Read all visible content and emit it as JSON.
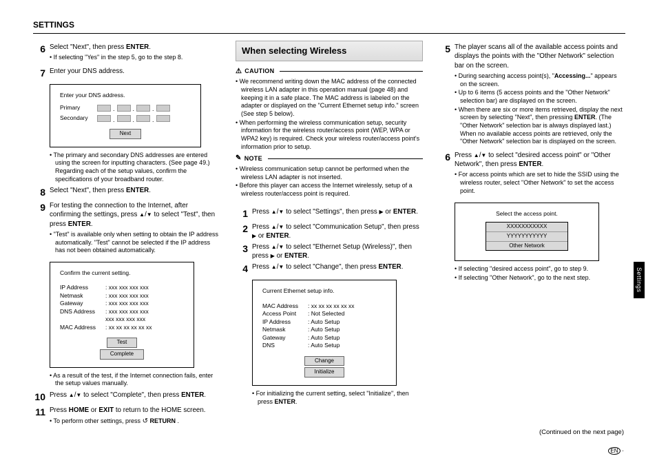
{
  "pageTitle": "SETTINGS",
  "sideTab": "Settings",
  "footer": {
    "continued": "(Continued on the next page)",
    "enMark": "EN"
  },
  "col1": {
    "s6": {
      "num": "6",
      "text": "Select \"Next\", then press ",
      "bold": "ENTER",
      "tail": ".",
      "bullets": [
        "If selecting \"Yes\" in the step 5, go to the step 8."
      ]
    },
    "s7": {
      "num": "7",
      "text": "Enter your DNS address."
    },
    "dnsBox": {
      "title": "Enter your DNS address.",
      "rows": [
        "Primary",
        "Secondary"
      ],
      "nextBtn": "Next"
    },
    "dnsNote": [
      "The primary and secondary DNS addresses are entered using the screen for inputting characters. (See page 49.)",
      "Regarding each of the setup values, confirm the specifications of your broadband router."
    ],
    "s8": {
      "num": "8",
      "text": "Select \"Next\", then press ",
      "bold": "ENTER",
      "tail": "."
    },
    "s9": {
      "num": "9",
      "text1": "For testing the connection to the Internet, after confirming the settings, press ",
      "text2": " to select \"Test\", then press ",
      "bold": "ENTER",
      "tail": ".",
      "bullets": [
        "\"Test\" is available only when setting to obtain the IP address automatically. \"Test\" cannot be selected if the IP address has not been obtained automatically."
      ]
    },
    "confirmBox": {
      "title": "Confirm the current setting.",
      "rows": [
        {
          "k": "IP Address",
          "v": ": xxx xxx xxx xxx"
        },
        {
          "k": "Netmask",
          "v": ": xxx xxx xxx xxx"
        },
        {
          "k": "Gateway",
          "v": ": xxx xxx xxx xxx"
        },
        {
          "k": "DNS Address",
          "v": ": xxx xxx xxx xxx"
        },
        {
          "k": "",
          "v": "  xxx xxx xxx xxx"
        },
        {
          "k": "MAC Address",
          "v": ": xx xx xx xx xx xx"
        }
      ],
      "btn1": "Test",
      "btn2": "Complete"
    },
    "confirmNote": [
      "As a result of the test, if the Internet connection fails, enter the setup values manually."
    ],
    "s10": {
      "num": "10",
      "text1": "Press ",
      "text2": " to select \"Complete\", then press ",
      "bold": "ENTER",
      "tail": "."
    },
    "s11": {
      "num": "11",
      "text1": "Press ",
      "b1": "HOME",
      "text2": " or ",
      "b2": "EXIT",
      "text3": " to return to the HOME screen.",
      "bullets_pre": "To perform other settings, press ",
      "bullets_bold": " RETURN",
      "bullets_post": " ."
    }
  },
  "col2": {
    "heading": "When selecting Wireless",
    "cautionLabel": "CAUTION",
    "cautionIcon": "⚠",
    "cautionBullets": [
      "We recommend writing down the MAC address of the connected wireless LAN adapter in this operation manual (page 48) and keeping it in a safe place. The MAC address is labeled on the adapter or displayed on the \"Current Ethernet setup info.\" screen (See step 5 below).",
      "When performing the wireless communication setup, security information for the wireless router/access point (WEP, WPA or WPA2 key) is required. Check your wireless router/access point's information prior to setup."
    ],
    "noteLabel": "NOTE",
    "noteIcon": "✎",
    "noteBullets": [
      "Wireless communication setup cannot be performed when the wireless LAN adapter is not inserted.",
      "Before this player can access the Internet wirelessly, setup of a wireless router/access point is required."
    ],
    "s1": {
      "num": "1",
      "text1": "Press ",
      "text2": " to select \"Settings\", then press ",
      "text3": " or ",
      "bold": "ENTER",
      "tail": "."
    },
    "s2": {
      "num": "2",
      "text1": "Press ",
      "text2": " to select \"Communication Setup\", then press ",
      "text3": " or ",
      "bold": "ENTER",
      "tail": "."
    },
    "s3": {
      "num": "3",
      "text1": "Press ",
      "text2": " to select \"Ethernet Setup (Wireless)\", then press ",
      "text3": " or ",
      "bold": "ENTER",
      "tail": "."
    },
    "s4": {
      "num": "4",
      "text1": "Press ",
      "text2": " to select \"Change\", then press ",
      "bold": "ENTER",
      "tail": "."
    },
    "ethBox": {
      "title": "Current Ethernet setup info.",
      "rows": [
        {
          "k": "MAC Address",
          "v": ": xx xx xx xx xx xx"
        },
        {
          "k": "Access Point",
          "v": ": Not Selected"
        },
        {
          "k": "IP Address",
          "v": ": Auto Setup"
        },
        {
          "k": "Netmask",
          "v": ": Auto Setup"
        },
        {
          "k": "Gateway",
          "v": ": Auto Setup"
        },
        {
          "k": "DNS",
          "v": ": Auto Setup"
        }
      ],
      "btn1": "Change",
      "btn2": "Initialize"
    },
    "ethNote_pre": "For initializing the current setting, select \"Initialize\", then press ",
    "ethNote_bold": "ENTER",
    "ethNote_post": "."
  },
  "col3": {
    "s5": {
      "num": "5",
      "text": "The player scans all of the available access points and displays the points with the \"Other Network\" selection bar on the screen.",
      "bullets": [
        {
          "pre": "During searching access point(s), \"",
          "bold": "Accessing...",
          "post": "\" appears on the screen."
        },
        {
          "text": "Up to 6 items (5 access points and the \"Other Network\" selection bar) are displayed on the screen."
        },
        {
          "pre": "When there are six or more items retrieved, display the next screen by selecting \"Next\", then pressing ",
          "bold": "ENTER",
          "post": ". (The \"Other Network\" selection bar is always displayed last.) When no available access points are retrieved, only the \"Other Network\" selection bar is displayed on the screen."
        }
      ]
    },
    "s6": {
      "num": "6",
      "text1": "Press ",
      "text2": " to select \"desired access point\" or \"Other Network\", then press ",
      "bold": "ENTER",
      "tail": ".",
      "bullets": [
        "For access points which are set to hide the SSID using the wireless router, select \"Other Network\" to set the access point."
      ]
    },
    "apBox": {
      "title": "Select the access point.",
      "items": [
        "XXXXXXXXXXX",
        "YYYYYYYYYYY",
        "Other Network"
      ]
    },
    "apNote": [
      "If selecting \"desired access point\", go to step 9.",
      "If selecting \"Other Network\", go to the next step."
    ]
  }
}
